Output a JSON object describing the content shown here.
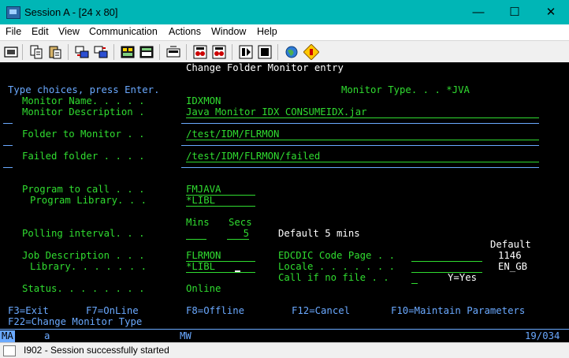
{
  "window": {
    "title": "Session A - [24 x 80]",
    "minimize": "—",
    "maximize": "☐",
    "close": "✕"
  },
  "menu": {
    "file": "File",
    "edit": "Edit",
    "view": "View",
    "communication": "Communication",
    "actions": "Actions",
    "window": "Window",
    "help": "Help"
  },
  "toolbar": {
    "icons": [
      "print-screen-icon",
      "copy-icon",
      "paste-icon",
      "send-receive-icon",
      "receive-file-icon",
      "display-keypad-icon",
      "macro-icon",
      "record-macro-icon",
      "stop-macro-icon",
      "play-macro-icon",
      "clear-icon",
      "help-globe-icon",
      "customize-icon"
    ]
  },
  "screen": {
    "header": "Change Folder Monitor entry",
    "prompt": "Type choices, press Enter.",
    "monitor_type_label": "Monitor Type. . . *JVA",
    "monitor_name_label": "Monitor Name. . . . .",
    "monitor_name_value": "IDXMON",
    "monitor_desc_label": "Monitor Description .",
    "monitor_desc_value": "Java Monitor IDX CONSUMEIDX.jar",
    "folder_label": "Folder to Monitor . .",
    "folder_value": "/test/IDM/FLRMON",
    "failed_label": "Failed folder . . . .",
    "failed_value": "/test/IDM/FLRMON/failed",
    "program_label": "Program to call . . .",
    "program_value": "FMJAVA",
    "program_lib_label": "Program Library. . .",
    "program_lib_value": "*LIBL",
    "mins_header": "Mins",
    "secs_header": "Secs",
    "polling_label": "Polling interval. . .",
    "polling_mins": "",
    "polling_secs": "5",
    "polling_default": "Default 5 mins",
    "default_header": "Default",
    "job_desc_label": "Job Description . . .",
    "job_desc_value": "FLRMON",
    "library_label": "Library. . . . . . .",
    "library_value": "*LIBL",
    "ebcdic_label": "EDCDIC Code Page . .",
    "ebcdic_default": "1146",
    "locale_label": "Locale . . . . . . .",
    "locale_default": "EN_GB",
    "call_label": "Call if no file . .",
    "call_hint": "Y=Yes",
    "status_label": "Status. . . . . . . .",
    "status_value": "Online",
    "f3": "F3=Exit",
    "f7": "F7=OnLine",
    "f8": "F8=Offline",
    "f12": "F12=Cancel",
    "f10": "F10=Maintain Parameters",
    "f22": "F22=Change Monitor Type"
  },
  "oia": {
    "ma": "MA",
    "a": "a",
    "mw": "MW",
    "position": "19/034"
  },
  "statusbar": {
    "message": "I902 - Session successfully started"
  }
}
